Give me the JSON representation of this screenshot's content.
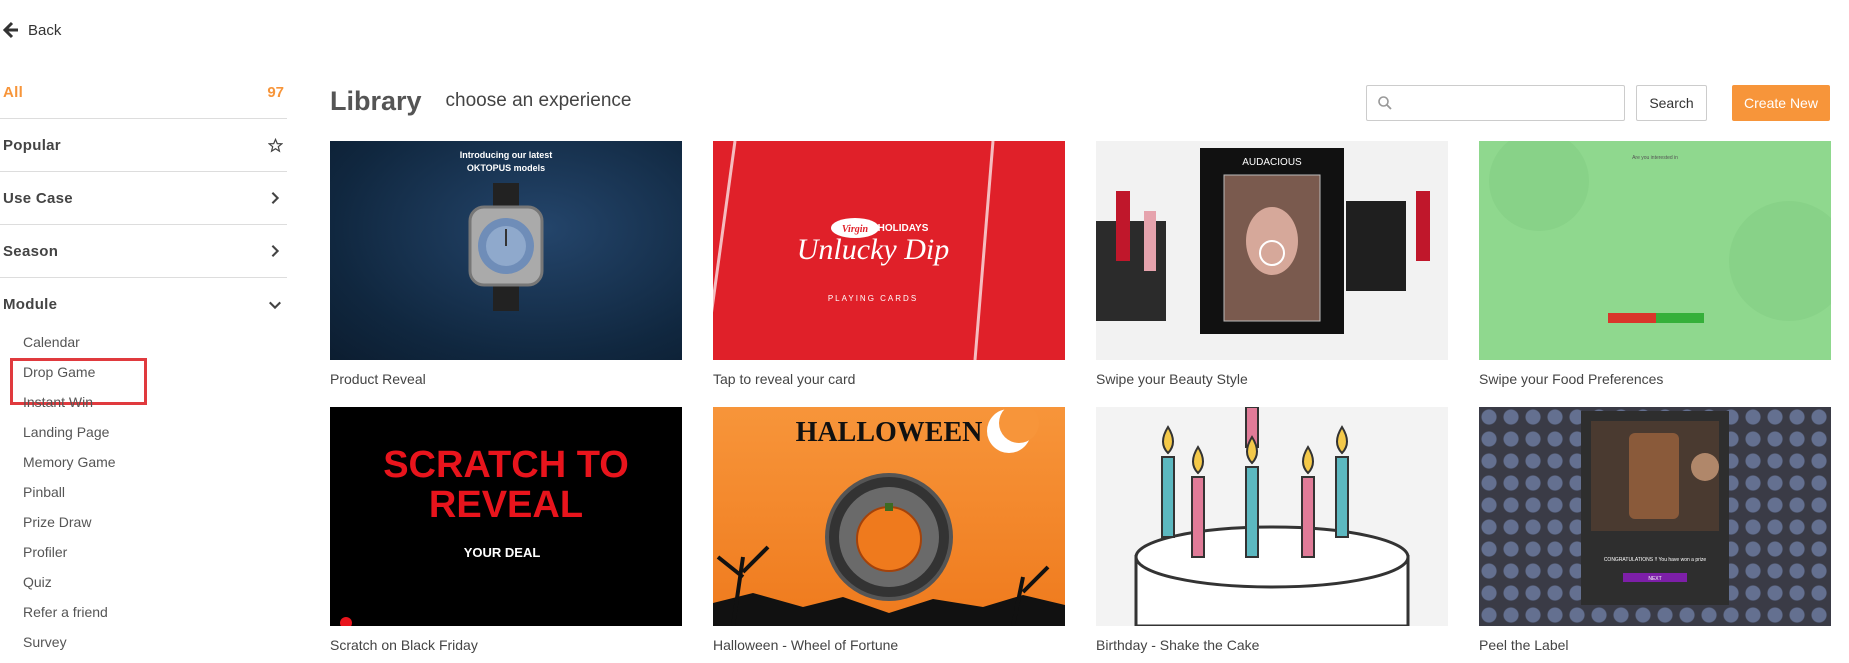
{
  "nav": {
    "back_label": "Back"
  },
  "sidebar": {
    "all": {
      "label": "All",
      "count": "97"
    },
    "categories": [
      {
        "label": "Popular"
      },
      {
        "label": "Use Case"
      },
      {
        "label": "Season"
      },
      {
        "label": "Module"
      }
    ],
    "modules": [
      "Calendar",
      "Drop Game",
      "Instant Win",
      "Landing Page",
      "Memory Game",
      "Pinball",
      "Prize Draw",
      "Profiler",
      "Quiz",
      "Refer a friend",
      "Survey"
    ],
    "highlighted_module": "Drop Game"
  },
  "main": {
    "title": "Library",
    "subtitle": "choose an experience",
    "search": {
      "placeholder": "",
      "button_label": "Search"
    },
    "create_label": "Create New",
    "cards": [
      {
        "title": "Product Reveal",
        "thumb_text": [
          "Introducing our latest",
          "OKTOPUS models"
        ]
      },
      {
        "title": "Tap to reveal your card",
        "thumb_text": [
          "HOLIDAYS",
          "Unlucky Dip",
          "PLAYING CARDS",
          "Virgin"
        ]
      },
      {
        "title": "Swipe your Beauty Style",
        "thumb_text": [
          "AUDACIOUS"
        ]
      },
      {
        "title": "Swipe your Food Preferences",
        "thumb_text": [
          "Are you interested in"
        ]
      },
      {
        "title": "Scratch on Black Friday",
        "thumb_text": [
          "SCRATCH TO",
          "REVEAL",
          "YOUR DEAL"
        ]
      },
      {
        "title": "Halloween - Wheel of Fortune",
        "thumb_text": [
          "HALLOWEEN"
        ]
      },
      {
        "title": "Birthday - Shake the Cake",
        "thumb_text": []
      },
      {
        "title": "Peel the Label",
        "thumb_text": [
          "CONGRATULATIONS !! You have won a prize",
          "NEXT"
        ]
      }
    ]
  },
  "colors": {
    "accent": "#f7953a",
    "highlight_box": "#e03a3e"
  }
}
